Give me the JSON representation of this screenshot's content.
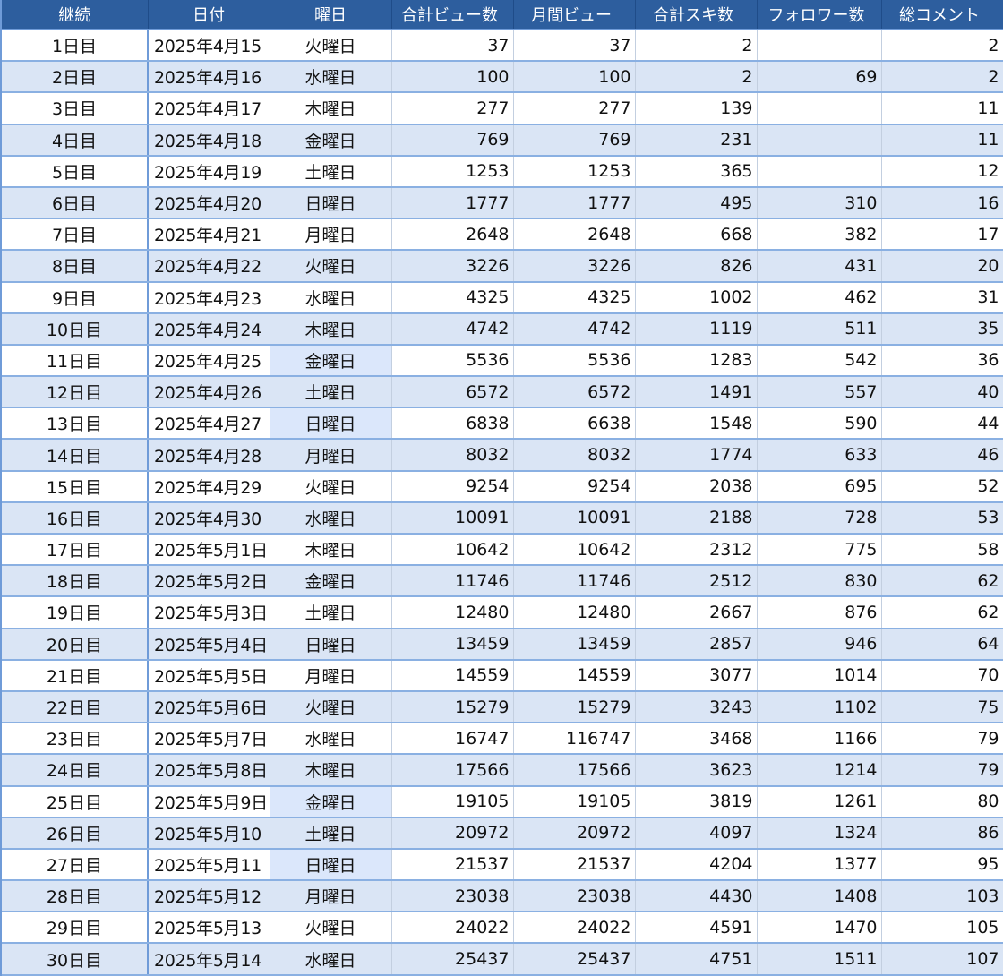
{
  "headers": [
    "継続",
    "日付",
    "曜日",
    "合計ビュー数",
    "月間ビュー",
    "合計スキ数",
    "フォロワー数",
    "総コメント"
  ],
  "rows": [
    [
      "1日目",
      "2025年4月15",
      "火曜日",
      "37",
      "37",
      "2",
      "",
      "2"
    ],
    [
      "2日目",
      "2025年4月16",
      "水曜日",
      "100",
      "100",
      "2",
      "69",
      "2"
    ],
    [
      "3日目",
      "2025年4月17",
      "木曜日",
      "277",
      "277",
      "139",
      "",
      "11"
    ],
    [
      "4日目",
      "2025年4月18",
      "金曜日",
      "769",
      "769",
      "231",
      "",
      "11"
    ],
    [
      "5日目",
      "2025年4月19",
      "土曜日",
      "1253",
      "1253",
      "365",
      "",
      "12"
    ],
    [
      "6日目",
      "2025年4月20",
      "日曜日",
      "1777",
      "1777",
      "495",
      "310",
      "16"
    ],
    [
      "7日目",
      "2025年4月21",
      "月曜日",
      "2648",
      "2648",
      "668",
      "382",
      "17"
    ],
    [
      "8日目",
      "2025年4月22",
      "火曜日",
      "3226",
      "3226",
      "826",
      "431",
      "20"
    ],
    [
      "9日目",
      "2025年4月23",
      "水曜日",
      "4325",
      "4325",
      "1002",
      "462",
      "31"
    ],
    [
      "10日目",
      "2025年4月24",
      "木曜日",
      "4742",
      "4742",
      "1119",
      "511",
      "35"
    ],
    [
      "11日目",
      "2025年4月25",
      "金曜日",
      "5536",
      "5536",
      "1283",
      "542",
      "36"
    ],
    [
      "12日目",
      "2025年4月26",
      "土曜日",
      "6572",
      "6572",
      "1491",
      "557",
      "40"
    ],
    [
      "13日目",
      "2025年4月27",
      "日曜日",
      "6838",
      "6638",
      "1548",
      "590",
      "44"
    ],
    [
      "14日目",
      "2025年4月28",
      "月曜日",
      "8032",
      "8032",
      "1774",
      "633",
      "46"
    ],
    [
      "15日目",
      "2025年4月29",
      "火曜日",
      "9254",
      "9254",
      "2038",
      "695",
      "52"
    ],
    [
      "16日目",
      "2025年4月30",
      "水曜日",
      "10091",
      "10091",
      "2188",
      "728",
      "53"
    ],
    [
      "17日目",
      "2025年5月1日",
      "木曜日",
      "10642",
      "10642",
      "2312",
      "775",
      "58"
    ],
    [
      "18日目",
      "2025年5月2日",
      "金曜日",
      "11746",
      "11746",
      "2512",
      "830",
      "62"
    ],
    [
      "19日目",
      "2025年5月3日",
      "土曜日",
      "12480",
      "12480",
      "2667",
      "876",
      "62"
    ],
    [
      "20日目",
      "2025年5月4日",
      "日曜日",
      "13459",
      "13459",
      "2857",
      "946",
      "64"
    ],
    [
      "21日目",
      "2025年5月5日",
      "月曜日",
      "14559",
      "14559",
      "3077",
      "1014",
      "70"
    ],
    [
      "22日目",
      "2025年5月6日",
      "火曜日",
      "15279",
      "15279",
      "3243",
      "1102",
      "75"
    ],
    [
      "23日目",
      "2025年5月7日",
      "水曜日",
      "16747",
      "116747",
      "3468",
      "1166",
      "79"
    ],
    [
      "24日目",
      "2025年5月8日",
      "木曜日",
      "17566",
      "17566",
      "3623",
      "1214",
      "79"
    ],
    [
      "25日目",
      "2025年5月9日",
      "金曜日",
      "19105",
      "19105",
      "3819",
      "1261",
      "80"
    ],
    [
      "26日目",
      "2025年5月10",
      "土曜日",
      "20972",
      "20972",
      "4097",
      "1324",
      "86"
    ],
    [
      "27日目",
      "2025年5月11",
      "日曜日",
      "21537",
      "21537",
      "4204",
      "1377",
      "95"
    ],
    [
      "28日目",
      "2025年5月12",
      "月曜日",
      "23038",
      "23038",
      "4430",
      "1408",
      "103"
    ],
    [
      "29日目",
      "2025年5月13",
      "火曜日",
      "24022",
      "24022",
      "4591",
      "1470",
      "105"
    ],
    [
      "30日目",
      "2025年5月14",
      "水曜日",
      "25437",
      "25437",
      "4751",
      "1511",
      "107"
    ]
  ]
}
